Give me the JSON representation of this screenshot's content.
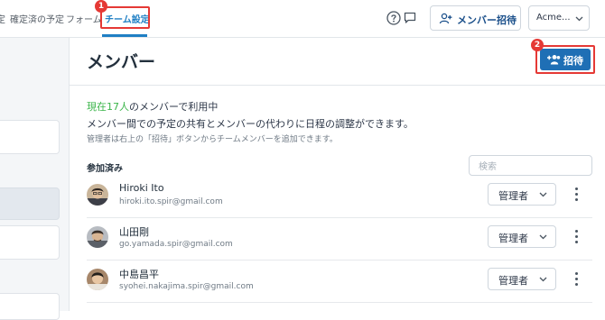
{
  "topnav": {
    "items": [
      {
        "label": "設定"
      },
      {
        "label": "確定済の予定"
      },
      {
        "label": "フォーム"
      },
      {
        "label": "チーム設定",
        "active": true
      }
    ],
    "annotation_1": "1",
    "help_icon": "question-circle-icon",
    "chat_icon": "speech-bubble-icon",
    "invite_member_label": "メンバー招待",
    "workspace_label": "Acme..."
  },
  "page": {
    "title": "メンバー",
    "invite_button_label": "招待",
    "annotation_2": "2",
    "usage_highlight": "現在17人",
    "usage_rest": "のメンバーで利用中",
    "description": "メンバー間での予定の共有とメンバーの代わりに日程の調整ができます。",
    "hint": "管理者は右上の「招待」ボタンからチームメンバーを追加できます。",
    "joined_heading": "参加済み",
    "search_placeholder": "検索"
  },
  "members": [
    {
      "name": "Hiroki Ito",
      "email": "hiroki.ito.spir@gmail.com",
      "role": "管理者"
    },
    {
      "name": "山田剛",
      "email": "go.yamada.spir@gmail.com",
      "role": "管理者"
    },
    {
      "name": "中島昌平",
      "email": "syohei.nakajima.spir@gmail.com",
      "role": "管理者"
    }
  ],
  "colors": {
    "accent": "#1f7fc4",
    "primary_button": "#1f6fb5",
    "highlight_text": "#3bb54a",
    "annotation_red": "#e53935"
  }
}
